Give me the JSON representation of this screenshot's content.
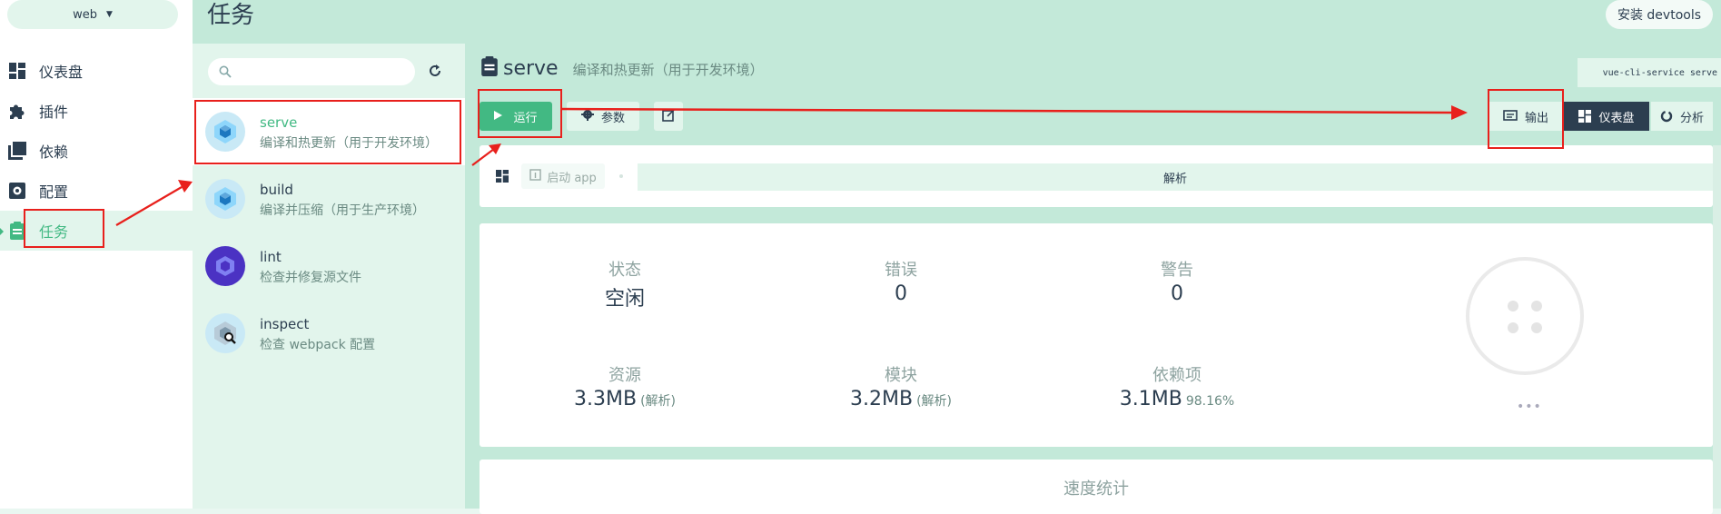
{
  "project": {
    "name": "web",
    "chevron_icon": "chevron-down-icon"
  },
  "nav": {
    "items": [
      {
        "label": "仪表盘",
        "icon": "dashboard-icon"
      },
      {
        "label": "插件",
        "icon": "puzzle-icon"
      },
      {
        "label": "依赖",
        "icon": "library-icon"
      },
      {
        "label": "配置",
        "icon": "settings-icon"
      },
      {
        "label": "任务",
        "icon": "clipboard-icon",
        "active": true
      }
    ]
  },
  "header": {
    "title": "任务",
    "devtools_button": "安装 devtools"
  },
  "tasks": {
    "search_placeholder": "",
    "items": [
      {
        "name": "serve",
        "description": "编译和热更新（用于开发环境）",
        "selected": true,
        "icon": "webpack-icon"
      },
      {
        "name": "build",
        "description": "编译并压缩（用于生产环境）",
        "icon": "webpack-icon"
      },
      {
        "name": "lint",
        "description": "检查并修复源文件",
        "icon": "eslint-icon"
      },
      {
        "name": "inspect",
        "description": "检查 webpack 配置",
        "icon": "webpack-inspect-icon"
      }
    ]
  },
  "detail": {
    "name": "serve",
    "description": "编译和热更新（用于开发环境）",
    "command": "vue-cli-service serve",
    "run_button": "运行",
    "params_button": "参数",
    "tabs": [
      {
        "label": "输出",
        "icon": "terminal-icon"
      },
      {
        "label": "仪表盘",
        "icon": "dashboard-icon",
        "active": true
      },
      {
        "label": "分析",
        "icon": "donut-icon"
      }
    ],
    "launch_app": "启动 app",
    "analyze_label": "解析",
    "stats": [
      {
        "label": "状态",
        "value": "空闲"
      },
      {
        "label": "错误",
        "value": "0"
      },
      {
        "label": "警告",
        "value": "0"
      },
      {
        "label": "资源",
        "value": "3.3MB",
        "sub": "(解析)"
      },
      {
        "label": "模块",
        "value": "3.2MB",
        "sub": "(解析)"
      },
      {
        "label": "依赖项",
        "value": "3.1MB",
        "sub": "98.16%"
      }
    ],
    "status_more": "•••",
    "speed_label": "速度统计"
  },
  "colors": {
    "accent": "#42b983",
    "dark": "#2c3e50",
    "annotation": "#e8201c"
  }
}
